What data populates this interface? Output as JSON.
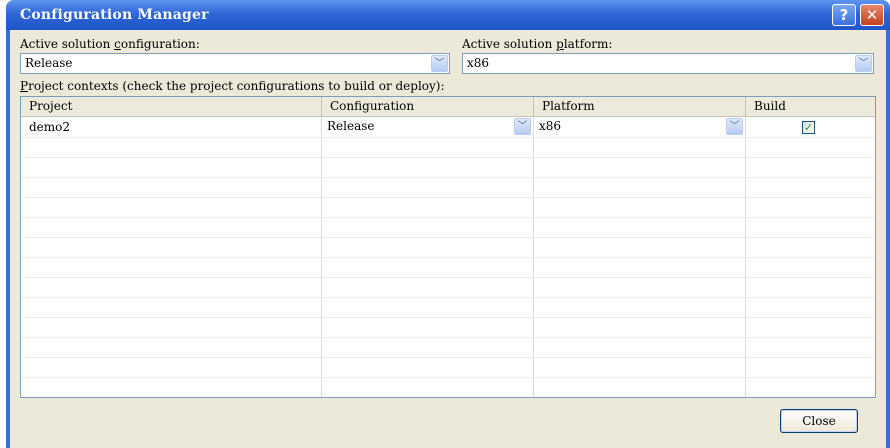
{
  "window": {
    "title": "Configuration Manager",
    "help_glyph": "?",
    "close_glyph": "✕"
  },
  "solution": {
    "config_label_pre": "Active solution ",
    "config_label_key": "c",
    "config_label_post": "onfiguration:",
    "config_value": "Release",
    "platform_label_pre": "Active solution ",
    "platform_label_key": "p",
    "platform_label_post": "latform:",
    "platform_value": "x86"
  },
  "contexts": {
    "label_key": "P",
    "label_rest": "roject contexts (check the project configurations to build or deploy):",
    "columns": [
      "Project",
      "Configuration",
      "Platform",
      "Build"
    ],
    "rows": [
      {
        "project": "demo2",
        "configuration": "Release",
        "platform": "x86",
        "build": true
      }
    ]
  },
  "buttons": {
    "close": "Close"
  },
  "icons": {
    "dropdown": "chevron-down-icon",
    "help": "help-icon",
    "close": "close-icon",
    "check": "checkmark-icon"
  },
  "colors": {
    "titlebar": "#2f67d6",
    "dialog_bg": "#ece9d8",
    "close_button": "#c4411f"
  }
}
